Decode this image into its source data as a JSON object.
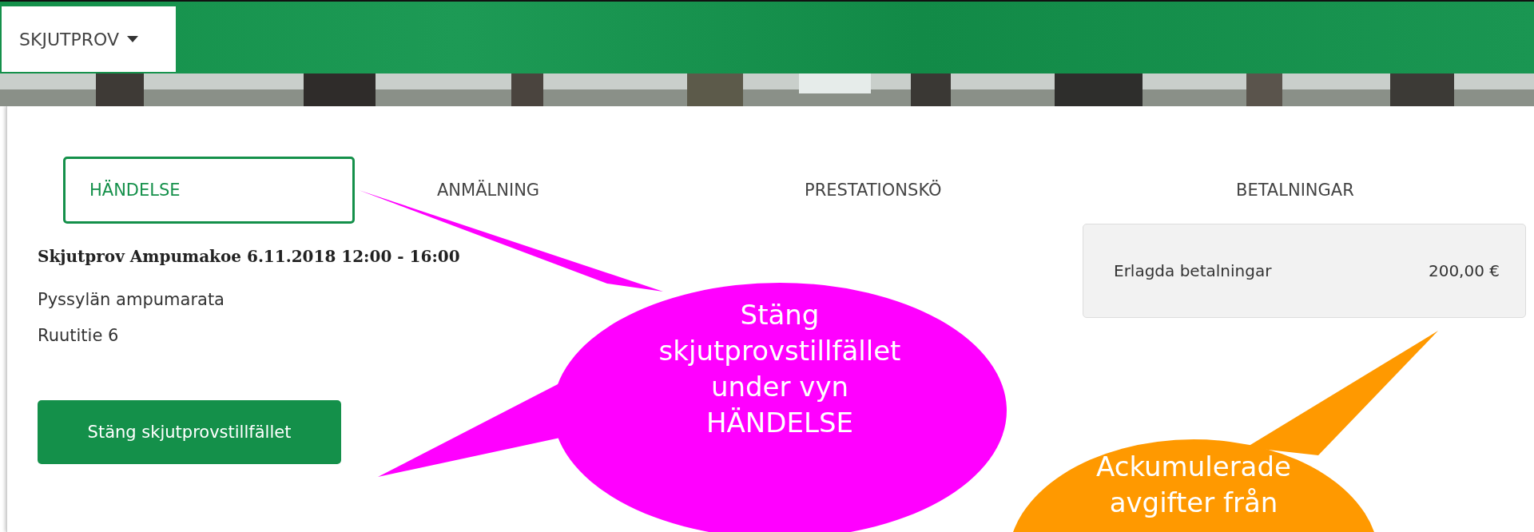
{
  "menu": {
    "label": "SKJUTPROV"
  },
  "tabs": [
    {
      "label": "HÄNDELSE",
      "selected": true
    },
    {
      "label": "ANMÄLNING",
      "selected": false
    },
    {
      "label": "PRESTATIONSKÖ",
      "selected": false
    },
    {
      "label": "BETALNINGAR",
      "selected": false
    }
  ],
  "event": {
    "title": "Skjutprov Ampumakoe 6.11.2018 12:00 - 16:00",
    "address_lines": [
      "Pyssylän ampumarata",
      "Ruutitie 6"
    ],
    "close_button": "Stäng skjutprovstillfället"
  },
  "payments": {
    "label": "Erlagda betalningar",
    "amount": "200,00 €"
  },
  "annotations": [
    {
      "kind": "magenta",
      "lines": [
        "Stäng",
        "skjutprovstillfället",
        "under vyn",
        "HÄNDELSE"
      ]
    },
    {
      "kind": "orange",
      "lines": [
        "Ackumulerade",
        "avgifter från"
      ]
    }
  ]
}
